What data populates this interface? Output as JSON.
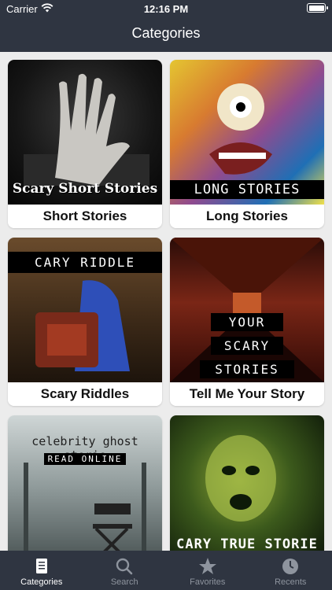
{
  "status_bar": {
    "carrier": "Carrier",
    "time": "12:16 PM"
  },
  "nav": {
    "title": "Categories"
  },
  "categories": [
    {
      "label": "Short Stories",
      "image_text": "Scary Short Stories"
    },
    {
      "label": "Long Stories",
      "image_text": "LONG STORIES"
    },
    {
      "label": "Scary Riddles",
      "image_text": "CARY RIDDLE"
    },
    {
      "label": "Tell Me Your Story",
      "image_text": [
        "YOUR",
        "SCARY",
        "STORIES"
      ]
    },
    {
      "label": "",
      "image_text": [
        "celebrity ghost storie",
        "READ ONLINE"
      ]
    },
    {
      "label": "",
      "image_text": "CARY TRUE STORIE"
    }
  ],
  "tabs": [
    {
      "label": "Categories",
      "icon": "document-icon",
      "active": true
    },
    {
      "label": "Search",
      "icon": "search-icon",
      "active": false
    },
    {
      "label": "Favorites",
      "icon": "star-icon",
      "active": false
    },
    {
      "label": "Recents",
      "icon": "clock-icon",
      "active": false
    }
  ]
}
